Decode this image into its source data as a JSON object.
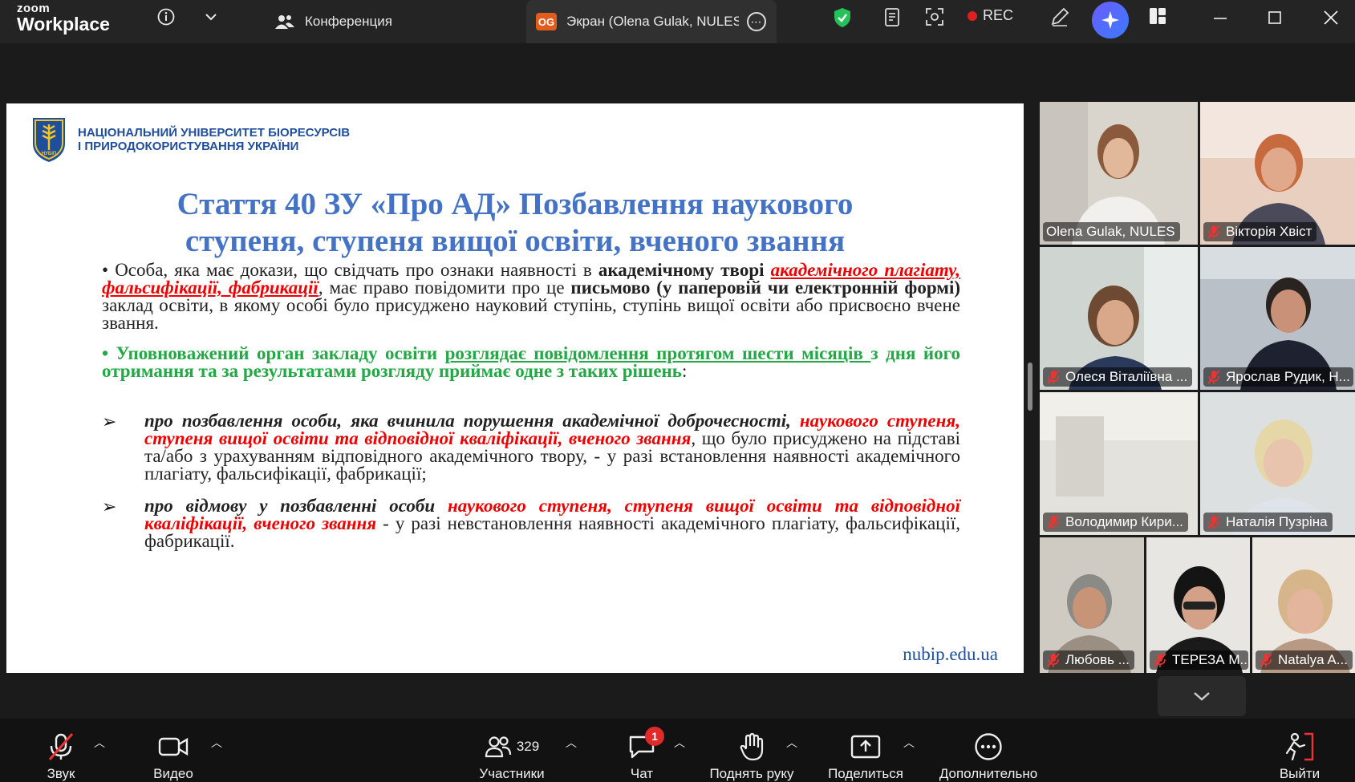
{
  "app": {
    "logo_top": "zoom",
    "logo_bottom": "Workplace"
  },
  "titlebar": {
    "meeting_tab": "Конференция",
    "share_tab": {
      "badge": "OG",
      "label": "Экран (Olena Gulak, NULES"
    },
    "rec_label": "REC"
  },
  "slide": {
    "university_line1": "НАЦІОНАЛЬНИЙ УНІВЕРСИТЕТ БІОРЕСУРСІВ",
    "university_line2": "І ПРИРОДОКОРИСТУВАННЯ УКРАЇНИ",
    "logo_caption": "НУБІП",
    "title_line1": "Стаття 40 ЗУ «Про АД» Позбавлення наукового",
    "title_line2": "ступеня, ступеня вищої освіти, вченого звання",
    "p1_a": "• Особа, яка має докази, що свідчать про ознаки наявності в ",
    "p1_b": "академічному творі",
    "p1_c": "академічного плагіату, фальсифікації, фабрикації",
    "p1_d": ", має право повідомити про це ",
    "p1_e": "письмово (у паперовій чи електронній формі)",
    "p1_f": " заклад освіти, в якому особі було присуджено науковий ступінь, ступінь вищої освіти або присвоєно вчене звання.",
    "p2_a": "• Уповноважений орган закладу освіти ",
    "p2_b": "розглядає повідомлення протягом шести місяців ",
    "p2_c": "з дня його отримання та за результатами розгляду приймає одне з таких рішень",
    "p2_d": ":",
    "b1_a": "про позбавлення особи, яка вчинила порушення академічної доброчесності, ",
    "b1_b": "наукового ступеня, ступеня вищої освіти та відповідної кваліфікації, вченого звання",
    "b1_c": ", що було присуджено на підставі та/або з урахуванням відповідного академічного твору, - у разі встановлення наявності академічного плагіату, фальсифікації, фабрикації;",
    "b2_a": "про відмову у позбавленні особи ",
    "b2_b": "наукового ступеня, ступеня вищої освіти та відповідної кваліфікації, вченого звання",
    "b2_c": " - у разі невстановлення наявності академічного плагіату, фальсифікації, фабрикації.",
    "arrow": "➢",
    "website": "nubip.edu.ua"
  },
  "participants_tiles": [
    {
      "name": "Olena Gulak, NULES",
      "muted": false,
      "active": true
    },
    {
      "name": "Вікторія Хвіст",
      "muted": true
    },
    {
      "name": "Олеся Віталіївна ...",
      "muted": true
    },
    {
      "name": "Ярослав Рудик, Н...",
      "muted": true
    },
    {
      "name": "Володимир Кири...",
      "muted": true
    },
    {
      "name": "Наталія Пузріна",
      "muted": true
    },
    {
      "name": "Любовь ...",
      "muted": true
    },
    {
      "name": "ТЕРЕЗА М...",
      "muted": true
    },
    {
      "name": "Natalya A...",
      "muted": true
    }
  ],
  "toolbar": {
    "audio": "Звук",
    "video": "Видео",
    "participants": "Участники",
    "participants_count": "329",
    "chat": "Чат",
    "chat_badge": "1",
    "raise_hand": "Поднять руку",
    "share": "Поделиться",
    "more": "Дополнительно",
    "leave": "Выйти"
  },
  "colors": {
    "accent_green": "#2ad36d",
    "rec_red": "#e02020",
    "slide_title_blue": "#4472c4"
  }
}
